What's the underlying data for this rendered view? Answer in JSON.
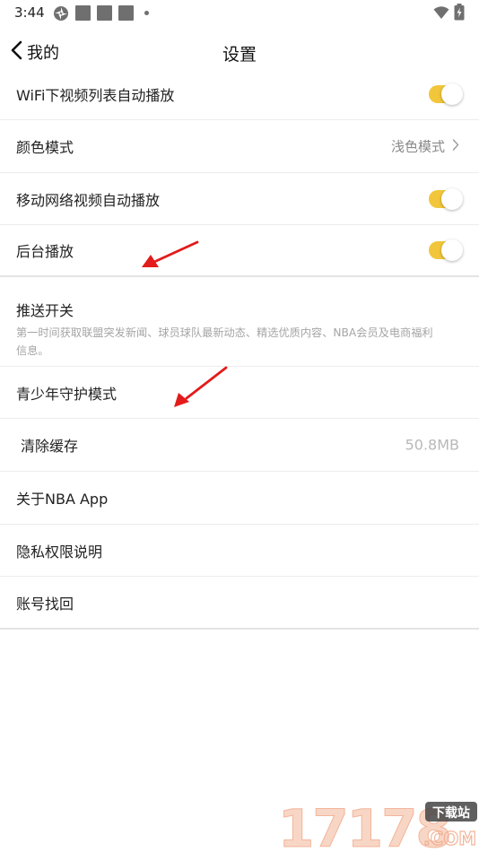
{
  "status_bar": {
    "time": "3:44"
  },
  "header": {
    "back_label": "我的",
    "title": "设置"
  },
  "settings": {
    "wifi_autoplay": {
      "label": "WiFi下视频列表自动播放",
      "enabled": true
    },
    "color_mode": {
      "label": "颜色模式",
      "value": "浅色模式"
    },
    "mobile_autoplay": {
      "label": "移动网络视频自动播放",
      "enabled": true
    },
    "background_play": {
      "label": "后台播放",
      "enabled": true
    },
    "push": {
      "label": "推送开关",
      "description": "第一时间获取联盟突发新闻、球员球队最新动态、精选优质内容、NBA会员及电商福利信息。"
    },
    "youth_mode": {
      "label": "青少年守护模式"
    },
    "clear_cache": {
      "label": "清除缓存",
      "value": "50.8MB"
    },
    "about": {
      "label": "关于NBA App"
    },
    "privacy": {
      "label": "隐私权限说明"
    },
    "account_recovery": {
      "label": "账号找回"
    }
  },
  "colors": {
    "toggle_on": "#f1c63a",
    "annotation_arrow": "#e31b1b"
  },
  "watermark": {
    "numerals": "17178",
    "tag": "下载站",
    "domain": ".COM"
  }
}
